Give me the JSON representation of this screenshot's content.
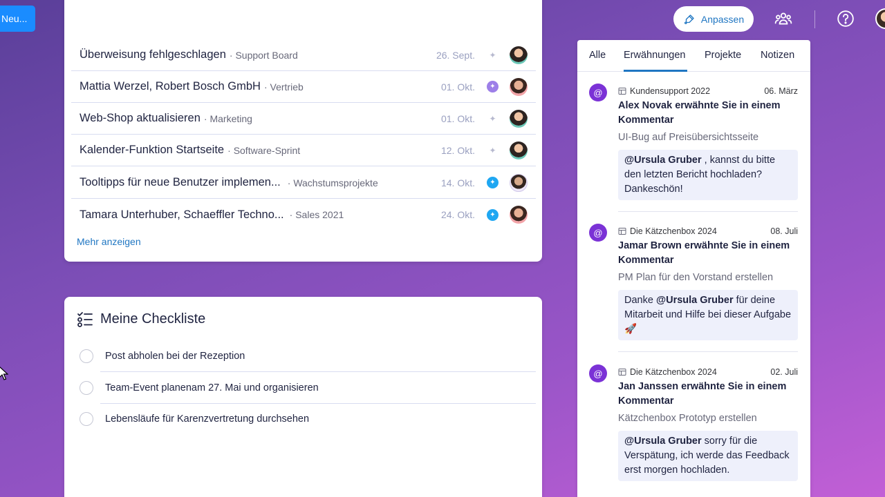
{
  "topbar": {
    "new_label": "Neu...",
    "customize_label": "Anpassen"
  },
  "updates": {
    "rows": [
      {
        "title": "Überweisung fehlgeschlagen",
        "board": "Support Board",
        "date": "26. Sept."
      },
      {
        "title": "Mattia Werzel, Robert Bosch GmbH",
        "board": "Vertrieb",
        "date": "01. Okt."
      },
      {
        "title": "Web-Shop aktualisieren",
        "board": "Marketing",
        "date": "01. Okt."
      },
      {
        "title": "Kalender-Funktion Startseite",
        "board": "Software-Sprint",
        "date": "12. Okt."
      },
      {
        "title": "Tooltipps für neue Benutzer implemen...",
        "board": "Wachstumsprojekte",
        "date": "14. Okt."
      },
      {
        "title": "Tamara Unterhuber, Schaeffler Techno...",
        "board": "Sales 2021",
        "date": "24. Okt."
      }
    ],
    "more_label": "Mehr anzeigen"
  },
  "checklist": {
    "title": "Meine Checkliste",
    "items": [
      "Post abholen bei der Rezeption",
      "Team-Event planenam 27. Mai und organisieren",
      "Lebensläufe für Karenzvertretung durchsehen"
    ]
  },
  "sidepanel": {
    "tabs": [
      "Alle",
      "Erwähnungen",
      "Projekte",
      "Notizen"
    ],
    "active_tab": "Erwähnungen",
    "mentions": [
      {
        "board": "Kundensupport 2022",
        "date": "06. März",
        "title": "Alex Novak erwähnte Sie in einem Kommentar",
        "subtitle": "UI-Bug auf Preisübersichtsseite",
        "mention": "@Ursula Gruber",
        "comment": " , kannst du bitte den letzten Bericht hochladen? Dankeschön!"
      },
      {
        "board": "Die Kätzchenbox 2024",
        "date": "08. Juli",
        "title": "Jamar Brown erwähnte Sie in einem Kommentar",
        "subtitle": "PM Plan für den Vorstand erstellen",
        "prefix": "Danke ",
        "mention": "@Ursula Gruber",
        "comment": " für deine Mitarbeit und Hilfe bei dieser Aufgabe 🚀"
      },
      {
        "board": "Die Kätzchenbox 2024",
        "date": "02. Juli",
        "title": "Jan Janssen erwähnte Sie in einem Kommentar",
        "subtitle": "Kätzchenbox Prototyp erstellen",
        "mention": "@Ursula Gruber",
        "comment": " sorry für die Verspätung, ich werde das Feedback erst morgen hochladen."
      }
    ]
  },
  "icons": {
    "customize": "paint-brush-icon",
    "team": "team-icon",
    "help": "help-icon",
    "pin": "pin-icon",
    "board": "board-icon",
    "mention": "at-icon",
    "checklist": "checklist-icon"
  },
  "colors": {
    "accent": "#1f76c2",
    "new_button": "#1a8cff",
    "mention_icon": "#7b32d6",
    "pin_purple": "#9d7fe8",
    "pin_blue": "#1fa7f2"
  }
}
